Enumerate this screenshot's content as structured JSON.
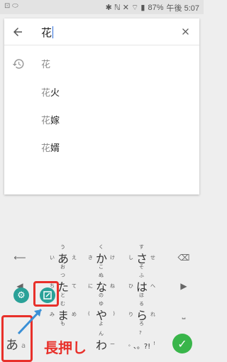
{
  "status_bar": {
    "left_icons": "⊡ ⬭",
    "battery": "87%",
    "time": "午後 5:07"
  },
  "search": {
    "query": "花"
  },
  "suggestions": [
    {
      "prefix": "花",
      "suffix": "",
      "history": true
    },
    {
      "prefix": "花",
      "suffix": "火",
      "history": false
    },
    {
      "prefix": "花",
      "suffix": "嫁",
      "history": false
    },
    {
      "prefix": "花",
      "suffix": "婿",
      "history": false
    }
  ],
  "keyboard": {
    "rows": [
      [
        {
          "c": "あ",
          "t": "う",
          "l": "い",
          "r": "え",
          "b": "お"
        },
        {
          "c": "か",
          "t": "く",
          "l": "き",
          "r": "け",
          "b": "こ"
        },
        {
          "c": "さ",
          "t": "す",
          "l": "し",
          "r": "せ",
          "b": "そ"
        }
      ],
      [
        {
          "c": "た",
          "t": "つ",
          "l": "ち",
          "r": "て",
          "b": "と"
        },
        {
          "c": "な",
          "t": "ぬ",
          "l": "に",
          "r": "ね",
          "b": "の"
        },
        {
          "c": "は",
          "t": "ふ",
          "l": "ひ",
          "r": "へ",
          "b": "ほ"
        }
      ],
      [
        {
          "c": "ま",
          "t": "む",
          "l": "み",
          "r": "め",
          "b": "も"
        },
        {
          "c": "や",
          "t": "ゆ",
          "l": "(",
          "r": ")",
          "b": "よ"
        },
        {
          "c": "ら",
          "t": "る",
          "l": "り",
          "r": "れ",
          "b": "ろ"
        }
      ],
      [
        {
          "c": "わ",
          "t": "ん",
          "l": "",
          "r": "ー",
          "b": ""
        },
        {
          "c": "、。?!",
          "t": "?",
          "l": "。",
          "r": "!",
          "b": ""
        }
      ]
    ],
    "kana_key": "あ",
    "kana_small": "a",
    "left_keys": [
      "⟵",
      "◀"
    ],
    "right_keys": [
      "⌫",
      "▶",
      "⎵"
    ]
  },
  "annotation": {
    "callout": "長押し",
    "accent_color": "#e8302a"
  },
  "colors": {
    "teal": "#2aa198",
    "green": "#39b54a"
  }
}
